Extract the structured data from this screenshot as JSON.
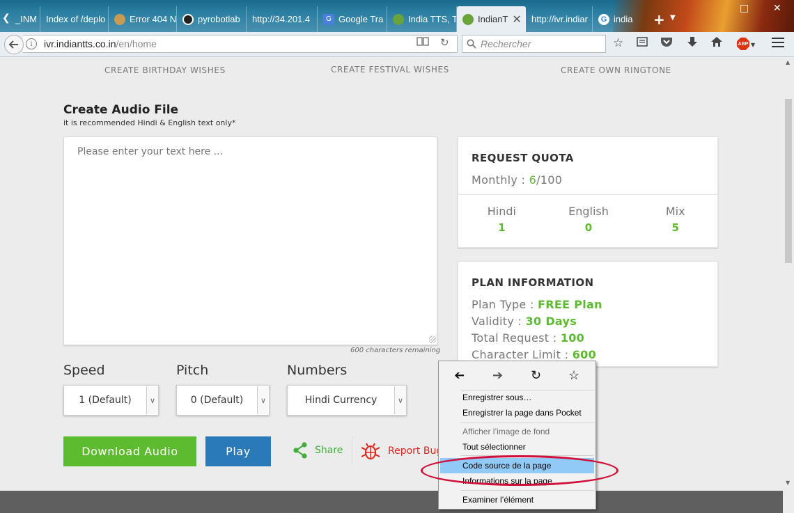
{
  "browser": {
    "tabs": [
      {
        "label": "_INM",
        "favicon_color": "#e8e8e8"
      },
      {
        "label": "Index of /deplo",
        "favicon_color": ""
      },
      {
        "label": "Error 404 N",
        "favicon_color": "#c89a52"
      },
      {
        "label": "pyrobotlab",
        "favicon_color": "#222222"
      },
      {
        "label": "http://34.201.4",
        "favicon_color": ""
      },
      {
        "label": "Google Tra",
        "favicon_color": "#4a7fdc"
      },
      {
        "label": "India TTS, T",
        "favicon_color": "#6aa33a"
      },
      {
        "label": "IndianT",
        "favicon_color": "#6aa33a",
        "active": true
      },
      {
        "label": "http://ivr.indiar",
        "favicon_color": ""
      },
      {
        "label": "india",
        "favicon_color": "#ffffff"
      }
    ],
    "tab_close_glyph": "✕",
    "new_tab_glyph": "+",
    "url": {
      "host": "ivr.indiantts.co.in",
      "path": "/en/home"
    },
    "search_placeholder": "Rechercher",
    "abp_label": "ABP"
  },
  "page": {
    "topnav": [
      "CREATE BIRTHDAY WISHES",
      "CREATE FESTIVAL WISHES",
      "CREATE OWN RINGTONE"
    ],
    "title": "Create Audio File",
    "subtitle": "it is recommended Hindi & English text only*",
    "textarea_placeholder": "Please enter your text here ...",
    "chars_remaining": "600 characters remaining",
    "selects": [
      {
        "label": "Speed",
        "value": "1 (Default)"
      },
      {
        "label": "Pitch",
        "value": "0 (Default)"
      },
      {
        "label": "Numbers",
        "value": "Hindi Currency"
      }
    ],
    "buttons": {
      "download": "Download Audio",
      "play": "Play",
      "share": "Share",
      "report_bug": "Report Bug"
    },
    "quota": {
      "heading": "REQUEST QUOTA",
      "monthly_label": "Monthly : ",
      "monthly_used": "6",
      "monthly_total": "/100",
      "columns": [
        {
          "name": "Hindi",
          "value": "1"
        },
        {
          "name": "English",
          "value": "0"
        },
        {
          "name": "Mix",
          "value": "5"
        }
      ]
    },
    "plan": {
      "heading": "PLAN INFORMATION",
      "rows": [
        {
          "label": "Plan Type : ",
          "value": "FREE Plan"
        },
        {
          "label": "Validity : ",
          "value": "30 Days"
        },
        {
          "label": "Total Request : ",
          "value": "100"
        },
        {
          "label": "Character Limit : ",
          "value": "600"
        }
      ]
    },
    "footer_text": "… … … … …",
    "accent_green": "#5dbb2f",
    "accent_blue": "#2a79b8",
    "accent_red": "#e2231a"
  },
  "context_menu": {
    "nav": [
      "back-arrow",
      "forward-arrow",
      "reload",
      "bookmark-star"
    ],
    "items": [
      {
        "label": "Enregistrer sous…",
        "mnemonic": "s"
      },
      {
        "label": "Enregistrer la page dans Pocket",
        "mnemonic": "k"
      },
      {
        "label": "Afficher l’image de fond",
        "disabled": true
      },
      {
        "label": "Tout sélectionner",
        "mnemonic": "T"
      },
      {
        "label": "Code source de la page",
        "highlighted": true
      },
      {
        "label": "Informations sur la page"
      },
      {
        "label": "Examiner l’élément"
      }
    ]
  }
}
